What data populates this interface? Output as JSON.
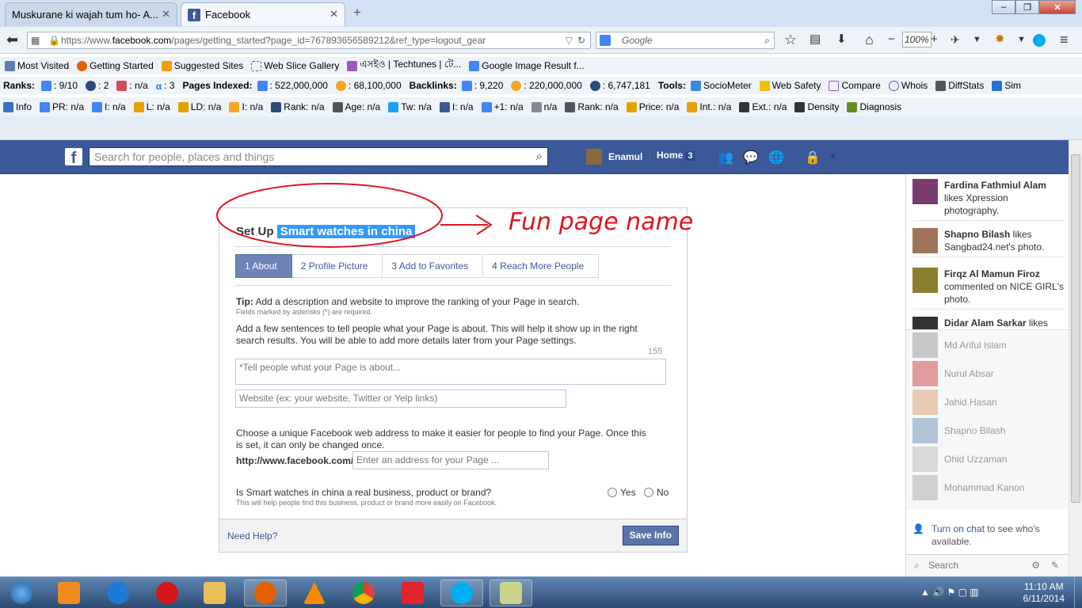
{
  "browser": {
    "tabs": [
      {
        "label": "Muskurane ki wajah tum ho- A...",
        "active": false
      },
      {
        "label": "Facebook",
        "active": true
      }
    ],
    "new_tab": "+",
    "url_host": "https://www.",
    "url_domain": "facebook.com",
    "url_rest": "/pages/getting_started?page_id=767893656589212&ref_type=logout_gear",
    "search_engine": "Google",
    "zoom": "100%"
  },
  "bookmarks": [
    "Most Visited",
    "Getting Started",
    "Suggested Sites",
    "Web Slice Gallery",
    "এসইও | Techtunes | টে...",
    "Google Image Result f..."
  ],
  "seobar": {
    "ranks_label": "Ranks:",
    "pr": ": 9/10",
    "r2": ": 2",
    "r3": ": n/a",
    "r4": ": 3",
    "pages_label": "Pages Indexed:",
    "pages_g": ": 522,000,000",
    "pages_b": ": 68,100,000",
    "backlinks_label": "Backlinks:",
    "bl_g": ": 9,220",
    "bl_b": ": 220,000,000",
    "bl_c": ": 6,747,181",
    "tools_label": "Tools:",
    "tools": [
      "SocioMeter",
      "Web Safety",
      "Compare",
      "Whois",
      "DiffStats",
      "Sim"
    ]
  },
  "infobar": [
    "Info",
    "PR: n/a",
    "I: n/a",
    "L: n/a",
    "LD: n/a",
    "I: n/a",
    "Rank: n/a",
    "Age: n/a",
    "Tw: n/a",
    "I: n/a",
    "+1: n/a",
    "n/a",
    "Rank: n/a",
    "Price: n/a",
    "Int.: n/a",
    "Ext.: n/a",
    "Density",
    "Diagnosis"
  ],
  "fb": {
    "search_placeholder": "Search for people, places and things",
    "user_name": "Enamul",
    "home_label": "Home",
    "home_count": "3"
  },
  "setup": {
    "prefix": "Set Up",
    "page_name": "Smart watches in china",
    "annotation": "Fun page name",
    "steps": [
      "1 About",
      "2 Profile Picture",
      "3 Add to Favorites",
      "4 Reach More People"
    ],
    "tip_bold": "Tip:",
    "tip_text": " Add a description and website to improve the ranking of your Page in search.",
    "required_note": "Fields marked by asterisks (*) are required.",
    "desc_line1": "Add a few sentences to tell people what your Page is about. This will help it show up in the right",
    "desc_line2": "search results. You will be able to add more details later from your Page settings.",
    "char_count": "155",
    "about_placeholder": "*Tell people what your Page is about...",
    "website_placeholder": "Website (ex: your website, Twitter or Yelp links)",
    "address_line1": "Choose a unique Facebook web address to make it easier for people to find your Page. Once this",
    "address_line2": "is set, it can only be changed once.",
    "address_prefix": "http://www.facebook.com/",
    "address_placeholder": "Enter an address for your Page ...",
    "business_q": "Is Smart watches in china a real business, product or brand?",
    "business_note": "This will help people find this business, product or brand more easily on Facebook.",
    "yes": "Yes",
    "no": "No",
    "need_help": "Need Help?",
    "save": "Save Info"
  },
  "ticker": [
    {
      "name": "Fardina Fathmiul Alam",
      "text": " likes Xpression photography."
    },
    {
      "name": "Shapno Bilash",
      "text": " likes Sangbad24.net's photo."
    },
    {
      "name": "Firqz Al Mamun Firoz",
      "text": " commented on NICE GIRL's photo."
    },
    {
      "name": "Didar Alam Sarkar",
      "text": " likes"
    }
  ],
  "chat": [
    "Md Ariful Islam",
    "Nurul Absar",
    "Jahid Hasan",
    "Shapno Bilash",
    "Ohid Uzzaman",
    "Mohammad Kanon"
  ],
  "chat_on_link": "Turn on chat",
  "chat_on_text": " to see who's available.",
  "chat_search": "Search",
  "clock": {
    "time": "11:10 AM",
    "date": "6/11/2014"
  },
  "colors": {
    "fb_blue": "#3b5998",
    "highlight": "#3399ff",
    "annotation_red": "#e0141e"
  }
}
